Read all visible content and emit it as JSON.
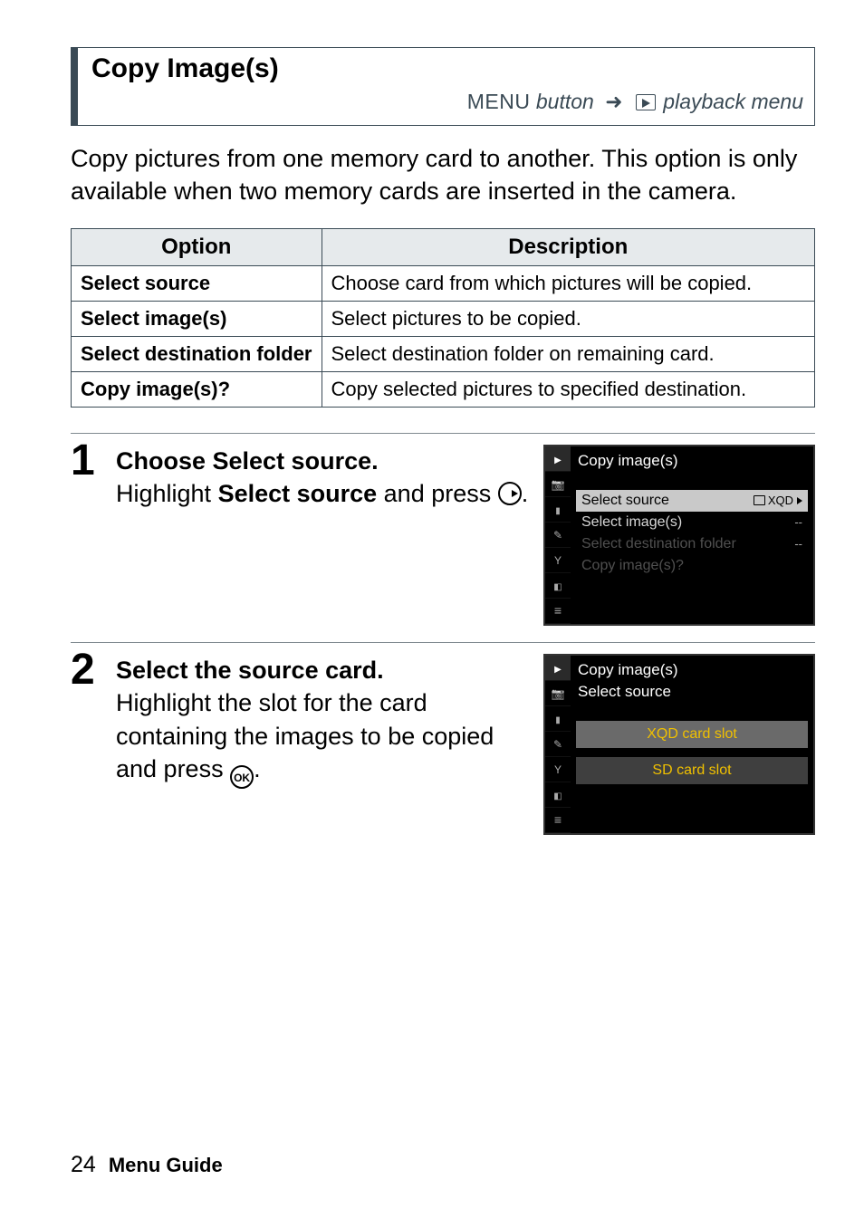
{
  "heading": {
    "title": "Copy Image(s)",
    "menu_word": "MENU",
    "button_word": "button",
    "trail": "playback menu"
  },
  "intro": "Copy pictures from one memory card to another.  This option is only available when two memory cards are inserted in the camera.",
  "table": {
    "head_option": "Option",
    "head_desc": "Description",
    "rows": [
      {
        "opt": "Select source",
        "desc": "Choose card from which pictures will be copied."
      },
      {
        "opt": "Select image(s)",
        "desc": "Select pictures to be copied."
      },
      {
        "opt": "Select destination folder",
        "desc": "Select destination folder on remaining card."
      },
      {
        "opt": "Copy image(s)?",
        "desc": "Copy selected pictures to specified destination."
      }
    ]
  },
  "steps": [
    {
      "num": "1",
      "title": "Choose Select source.",
      "body_pre": "Highlight ",
      "body_bold": "Select source",
      "body_post": " and press ",
      "icon": "right",
      "screenshot": {
        "title": "Copy image(s)",
        "items": [
          {
            "label": "Select source",
            "rt": "XQD",
            "state": "sel"
          },
          {
            "label": "Select image(s)",
            "rt": "--",
            "state": "norm"
          },
          {
            "label": "Select destination folder",
            "rt": "--",
            "state": "dim"
          },
          {
            "label": "Copy image(s)?",
            "rt": "",
            "state": "dim"
          }
        ]
      }
    },
    {
      "num": "2",
      "title": "Select the source card.",
      "body_pre": "Highlight the slot for the card containing the images to be copied and press ",
      "body_bold": "",
      "body_post": "",
      "icon": "ok",
      "screenshot": {
        "title": "Copy image(s)",
        "subtitle": "Select source",
        "slots": [
          {
            "label": "XQD card slot",
            "sel": true
          },
          {
            "label": "SD card slot",
            "sel": false
          }
        ]
      }
    }
  ],
  "footer": {
    "page": "24",
    "label": "Menu Guide"
  }
}
